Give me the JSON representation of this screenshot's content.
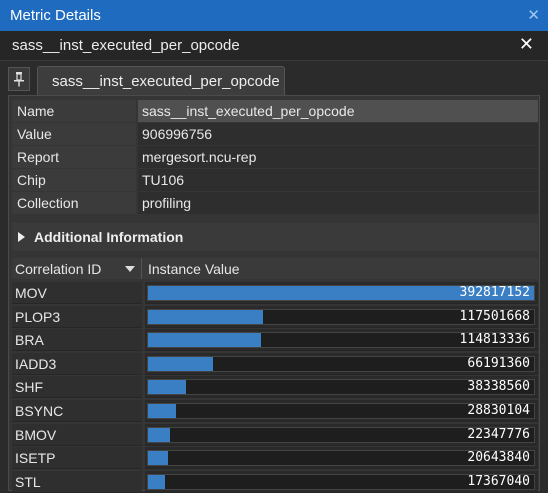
{
  "window": {
    "title": "Metric Details"
  },
  "metric_name": "sass__inst_executed_per_opcode",
  "tab": {
    "label": "sass__inst_executed_per_opcode"
  },
  "properties": [
    {
      "key": "Name",
      "value": "sass__inst_executed_per_opcode"
    },
    {
      "key": "Value",
      "value": "906996756"
    },
    {
      "key": "Report",
      "value": "mergesort.ncu-rep"
    },
    {
      "key": "Chip",
      "value": "TU106"
    },
    {
      "key": "Collection",
      "value": "profiling"
    }
  ],
  "additional": {
    "label": "Additional Information"
  },
  "table": {
    "headers": {
      "id": "Correlation ID",
      "value": "Instance Value"
    },
    "max_value": 392817152,
    "rows": [
      {
        "id": "MOV",
        "value": "392817152",
        "n": 392817152
      },
      {
        "id": "PLOP3",
        "value": "117501668",
        "n": 117501668
      },
      {
        "id": "BRA",
        "value": "114813336",
        "n": 114813336
      },
      {
        "id": "IADD3",
        "value": "66191360",
        "n": 66191360
      },
      {
        "id": "SHF",
        "value": "38338560",
        "n": 38338560
      },
      {
        "id": "BSYNC",
        "value": "28830104",
        "n": 28830104
      },
      {
        "id": "BMOV",
        "value": "22347776",
        "n": 22347776
      },
      {
        "id": "ISETP",
        "value": "20643840",
        "n": 20643840
      },
      {
        "id": "STL",
        "value": "17367040",
        "n": 17367040
      }
    ]
  },
  "colors": {
    "accent": "#1e6bbf",
    "bar": "#3a7fc4"
  },
  "icons": {
    "pin": "pin-icon",
    "close": "close-icon",
    "expand": "triangle-right-icon",
    "sort": "sort-down-icon"
  }
}
